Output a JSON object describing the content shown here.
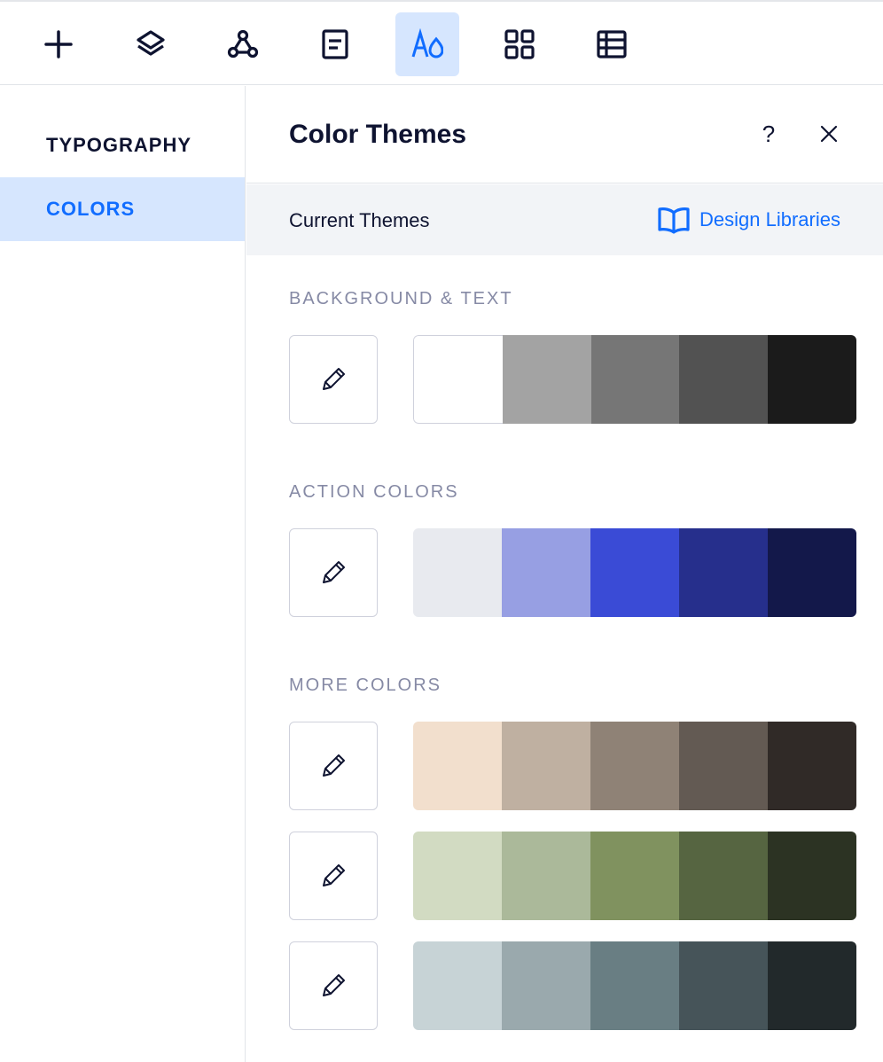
{
  "toolbar": {
    "tools": [
      {
        "icon": "plus-icon",
        "active": false
      },
      {
        "icon": "layers-icon",
        "active": false
      },
      {
        "icon": "connections-icon",
        "active": false
      },
      {
        "icon": "page-icon",
        "active": false
      },
      {
        "icon": "theme-icon",
        "active": true
      },
      {
        "icon": "apps-grid-icon",
        "active": false
      },
      {
        "icon": "table-icon",
        "active": false
      }
    ],
    "accent_color": "#116dff"
  },
  "sidebar": {
    "items": [
      {
        "label": "TYPOGRAPHY",
        "active": false
      },
      {
        "label": "COLORS",
        "active": true
      }
    ]
  },
  "panel": {
    "title": "Color Themes",
    "help_label": "?",
    "close_label": "×",
    "subheader": {
      "title": "Current Themes",
      "link_label": "Design Libraries"
    },
    "sections": {
      "background_text": "BACKGROUND & TEXT",
      "action_colors": "ACTION COLORS",
      "more_colors": "MORE COLORS"
    },
    "palettes": {
      "background_text": [
        "#ffffff",
        "#a3a3a3",
        "#767676",
        "#525252",
        "#1b1b1b"
      ],
      "action_colors": [
        "#e8eaef",
        "#979fe3",
        "#3a4bd6",
        "#262f8c",
        "#13184a"
      ],
      "more_colors": [
        [
          "#f2dfcd",
          "#bfb0a1",
          "#8f8276",
          "#635a53",
          "#302a27"
        ],
        [
          "#d2dbc2",
          "#abb99a",
          "#80925f",
          "#566541",
          "#2c3323"
        ],
        [
          "#c7d3d6",
          "#9aa9ad",
          "#697e83",
          "#465459",
          "#22292b"
        ]
      ]
    }
  }
}
